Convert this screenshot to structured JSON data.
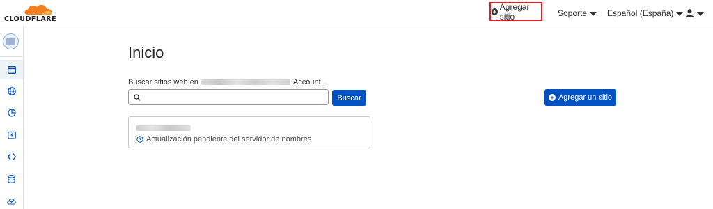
{
  "brand": {
    "logo_text": "CLOUDFLARE",
    "accent": "#f38020"
  },
  "topnav": {
    "add_site": "Agregar sitio",
    "support": "Soporte",
    "language": "Español (España)"
  },
  "sidebar": {
    "items": [
      {
        "icon": "browser-window-icon",
        "active": true
      },
      {
        "icon": "globe-icon"
      },
      {
        "icon": "pie-chart-icon"
      },
      {
        "icon": "lightning-shield-icon"
      },
      {
        "icon": "code-tag-icon"
      },
      {
        "icon": "database-icon"
      },
      {
        "icon": "cloud-upload-icon"
      }
    ]
  },
  "main": {
    "title": "Inicio",
    "search_label_prefix": "Buscar sitios web en",
    "search_label_suffix": "Account...",
    "search_value": "",
    "search_button": "Buscar",
    "add_site_button": "Agregar un sitio"
  },
  "sites": [
    {
      "status": "Actualización pendiente del servidor de nombres"
    }
  ],
  "colors": {
    "primary": "#0051c3",
    "highlight": "#e0202b"
  }
}
